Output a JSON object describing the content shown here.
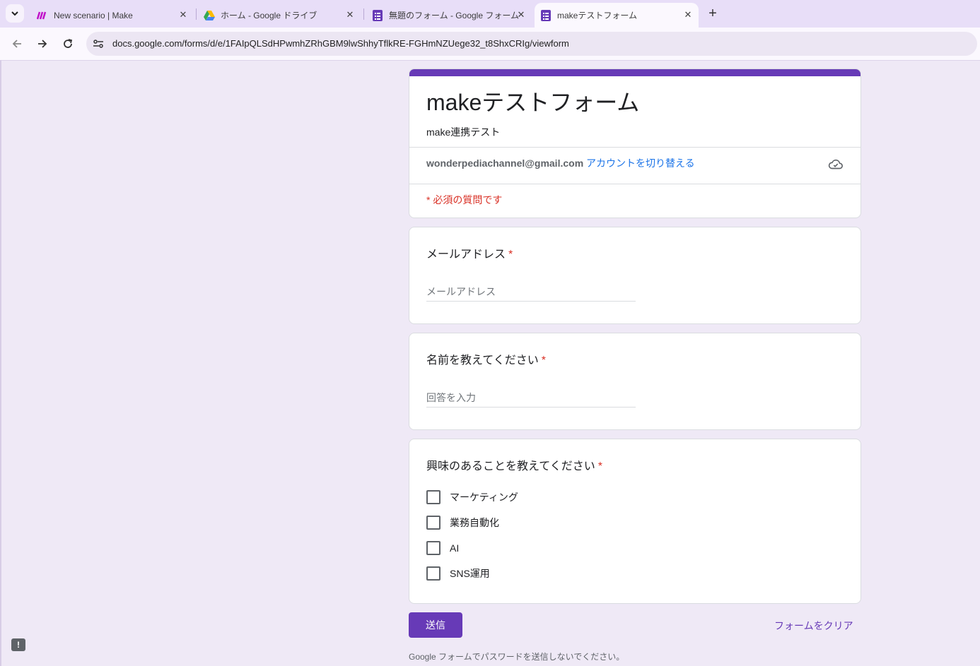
{
  "browser": {
    "tabs": [
      {
        "title": "New scenario | Make",
        "icon": "make-logo-icon",
        "active": false
      },
      {
        "title": "ホーム - Google ドライブ",
        "icon": "google-drive-icon",
        "active": false
      },
      {
        "title": "無題のフォーム - Google フォーム",
        "icon": "google-forms-icon",
        "active": false
      },
      {
        "title": "makeテストフォーム",
        "icon": "google-forms-icon",
        "active": true
      }
    ],
    "url": "docs.google.com/forms/d/e/1FAIpQLSdHPwmhZRhGBM9lwShhyTflkRE-FGHmNZUege32_t8ShxCRIg/viewform"
  },
  "form": {
    "title": "makeテストフォーム",
    "description": "make連携テスト",
    "account_email": "wonderpediachannel@gmail.com",
    "switch_account": "アカウントを切り替える",
    "required_note": "* 必須の質問です",
    "questions": [
      {
        "title": "メールアドレス",
        "required": "*",
        "placeholder": "メールアドレス"
      },
      {
        "title": "名前を教えてください",
        "required": "*",
        "placeholder": "回答を入力"
      },
      {
        "title": "興味のあることを教えてください",
        "required": "*",
        "options": [
          "マーケティング",
          "業務自動化",
          "AI",
          "SNS運用"
        ]
      }
    ],
    "submit_label": "送信",
    "clear_label": "フォームをクリア",
    "footer_note": "Google フォームでパスワードを送信しないでください。"
  },
  "colors": {
    "accent": "#673ab7",
    "required": "#d93025",
    "link": "#1a73e8"
  }
}
